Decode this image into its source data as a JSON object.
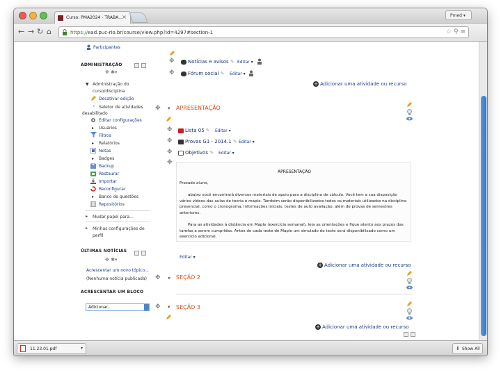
{
  "browser": {
    "tab_title": "Curso: PMA2024 - TRABA...",
    "profile_label": "Pmed",
    "url_secure": "https://",
    "url_rest": "ead.puc-rio.br/course/view.php?id=4297#section-1"
  },
  "sidebar": {
    "participants": "Participantes",
    "admin_heading": "ADMINISTRAÇÃO",
    "admin_items": [
      {
        "label": "Administração do",
        "label2": "curso/disciplina"
      },
      {
        "label": "Desativar edição"
      },
      {
        "label": "Seletor de atividades",
        "label2": "desabilitado"
      },
      {
        "label": "Editar configurações"
      },
      {
        "label": "Usuários"
      },
      {
        "label": "Filtros"
      },
      {
        "label": "Relatórios"
      },
      {
        "label": "Notas"
      },
      {
        "label": "Badges"
      },
      {
        "label": "Backup"
      },
      {
        "label": "Restaurar"
      },
      {
        "label": "Importar"
      },
      {
        "label": "Reconfigurar"
      },
      {
        "label": "Banco de questões"
      },
      {
        "label": "Repositórios"
      }
    ],
    "role_switch": "Mudar papel para...",
    "my_settings": "Minhas configurações de",
    "my_settings2": "perfil",
    "news_heading": "ÚLTIMAS NOTÍCIAS",
    "add_topic": "Acrescentar um novo tópico...",
    "no_news": "(Nenhuma notícia publicada)",
    "add_block_heading": "ACRESCENTAR UM BLOCO",
    "add_block_select": "Adicionar..."
  },
  "main": {
    "top_items": [
      {
        "label": "Notícias e avisos",
        "edit": "Editar"
      },
      {
        "label": "Fórum social",
        "edit": "Editar"
      }
    ],
    "add_activity": "Adicionar uma atividade ou recurso",
    "section1_title": "APRESENTAÇÃO",
    "section1_items": [
      {
        "label": "Lista 05",
        "edit": "Editar"
      },
      {
        "label": "Provas G1 - 2014.1",
        "edit": "Editar"
      },
      {
        "label": "Objetivos",
        "edit": "Editar"
      }
    ],
    "apresentacao": {
      "title": "APRESENTAÇÃO",
      "greeting": "Prezado aluno,",
      "para1": "abaixo você encontrará diversos materiais de apoio para a disciplina de cálculo. Você tem a sua disposição vários vídeos das aulas de teoria e maple. Também serão disponibilizados todos os materiais utilizados na disciplina presencial, como o cronograma, informações iniciais, testes de auto avaliação, além de provas de semestres anteriores.",
      "para2": "Para as atividades à distância em Maple (exercício semanal), leia as orientações e fique atento aos prazos das tarefas a serem cumpridas. Antes de cada teste de Maple um simulado do teste será disponibilizado como um exercício adicional."
    },
    "label_edit": "Editar",
    "section2_title": "SEÇÃO 2",
    "section3_title": "SEÇÃO 3"
  },
  "download": {
    "file": "11.23.01.pdf",
    "show_all": "Show All"
  },
  "colors": {
    "section_title": "#d2501a",
    "link": "#1a3a8a",
    "scroll_thumb": "#2f74c8"
  }
}
